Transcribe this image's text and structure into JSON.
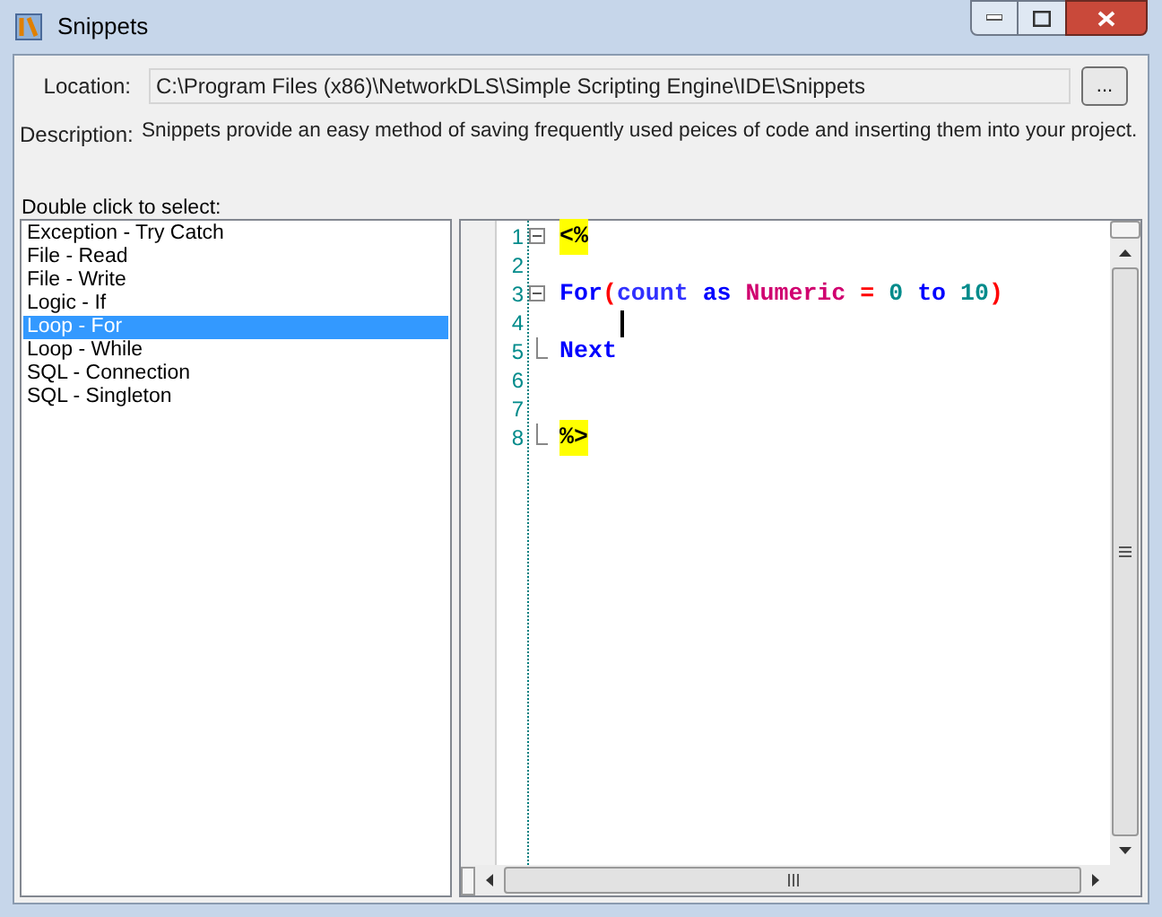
{
  "window": {
    "title": "Snippets"
  },
  "location": {
    "label": "Location:",
    "value": "C:\\Program Files (x86)\\NetworkDLS\\Simple Scripting Engine\\IDE\\Snippets",
    "browse_button": "..."
  },
  "description": {
    "label": "Description:",
    "text": "Snippets provide an easy method of saving frequently used peices of code and inserting them into your project."
  },
  "list_label": "Double click to select:",
  "snippets": [
    {
      "label": "Exception - Try Catch",
      "selected": false
    },
    {
      "label": "File - Read",
      "selected": false
    },
    {
      "label": "File - Write",
      "selected": false
    },
    {
      "label": "Logic - If",
      "selected": false
    },
    {
      "label": "Loop - For",
      "selected": true
    },
    {
      "label": "Loop - While",
      "selected": false
    },
    {
      "label": "SQL - Connection",
      "selected": false
    },
    {
      "label": "SQL - Singleton",
      "selected": false
    }
  ],
  "editor": {
    "lines": [
      {
        "number": "1",
        "kind": "fold_start",
        "tokens": [
          {
            "text": "<%",
            "kind": "marker"
          }
        ]
      },
      {
        "number": "2",
        "kind": "plain"
      },
      {
        "number": "3",
        "kind": "fold_start",
        "tokens": [
          {
            "text": "For",
            "kind": "keyword"
          },
          {
            "text": "(",
            "kind": "operator"
          },
          {
            "text": "count ",
            "kind": "identifier"
          },
          {
            "text": "as ",
            "kind": "keyword"
          },
          {
            "text": "Numeric ",
            "kind": "type"
          },
          {
            "text": "= ",
            "kind": "operator"
          },
          {
            "text": "0 ",
            "kind": "number"
          },
          {
            "text": "to ",
            "kind": "keyword"
          },
          {
            "text": "10",
            "kind": "number"
          },
          {
            "text": ")",
            "kind": "operator"
          }
        ]
      },
      {
        "number": "4",
        "kind": "cursor"
      },
      {
        "number": "5",
        "kind": "fold_end",
        "tokens": [
          {
            "text": "Next",
            "kind": "keyword"
          }
        ]
      },
      {
        "number": "6",
        "kind": "plain"
      },
      {
        "number": "7",
        "kind": "plain"
      },
      {
        "number": "8",
        "kind": "fold_end",
        "tokens": [
          {
            "text": "%>",
            "kind": "marker"
          }
        ]
      }
    ]
  }
}
